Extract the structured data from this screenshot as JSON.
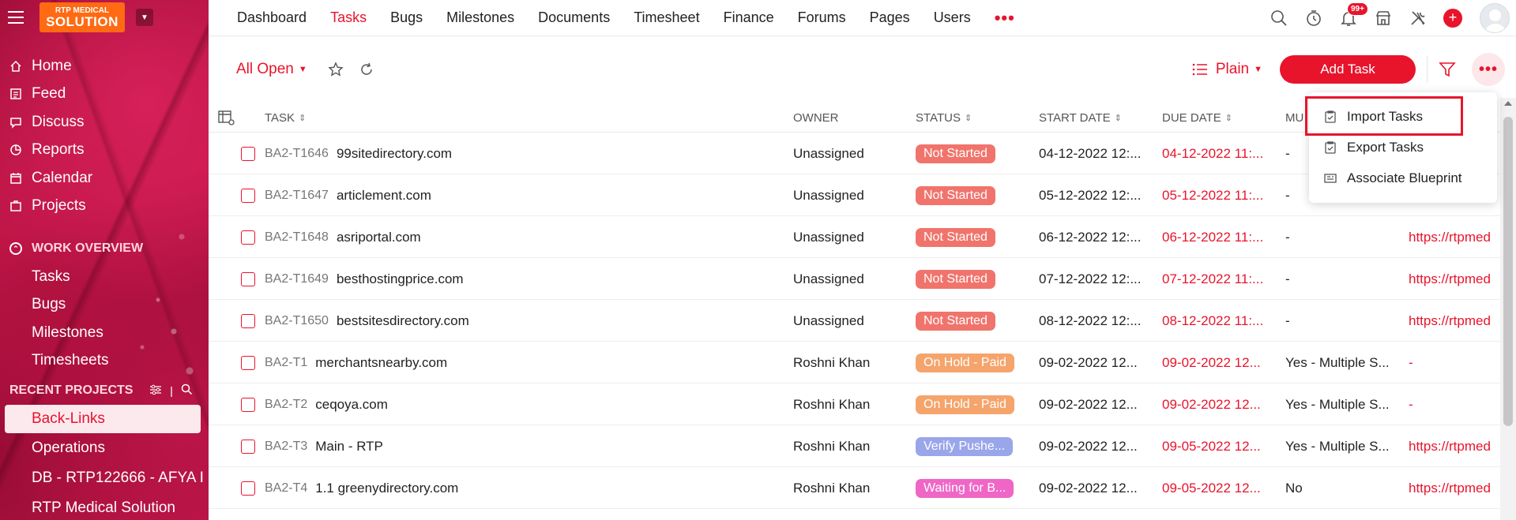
{
  "sidebar": {
    "logo": {
      "line1": "RTP MEDICAL",
      "line2": "SOLUTION"
    },
    "nav": [
      {
        "label": "Home",
        "icon": "home-icon"
      },
      {
        "label": "Feed",
        "icon": "feed-icon"
      },
      {
        "label": "Discuss",
        "icon": "discuss-icon"
      },
      {
        "label": "Reports",
        "icon": "reports-icon"
      },
      {
        "label": "Calendar",
        "icon": "calendar-icon"
      },
      {
        "label": "Projects",
        "icon": "projects-icon"
      }
    ],
    "work_overview": {
      "title": "WORK OVERVIEW",
      "items": [
        "Tasks",
        "Bugs",
        "Milestones",
        "Timesheets"
      ]
    },
    "recent_projects": {
      "title": "RECENT PROJECTS",
      "items": [
        "Back-Links",
        "Operations",
        "DB - RTP122666 - AFYA I",
        "RTP Medical Solution"
      ]
    }
  },
  "topnav": {
    "items": [
      "Dashboard",
      "Tasks",
      "Bugs",
      "Milestones",
      "Documents",
      "Timesheet",
      "Finance",
      "Forums",
      "Pages",
      "Users"
    ],
    "active": "Tasks",
    "more": "•••",
    "notification_count": "99+"
  },
  "toolbar": {
    "view": "All Open",
    "layout": "Plain",
    "add_task": "Add Task",
    "more": "•••"
  },
  "table": {
    "headers": {
      "task": "TASK",
      "owner": "OWNER",
      "status": "STATUS",
      "start": "START DATE",
      "due": "DUE DATE",
      "mu": "MU"
    },
    "rows": [
      {
        "id": "BA2-T1646",
        "name": "99sitedirectory.com",
        "owner": "Unassigned",
        "status": "Not Started",
        "status_color": "#f0746c",
        "start": "04-12-2022 12:...",
        "due": "04-12-2022 11:...",
        "multi": "-",
        "link": ""
      },
      {
        "id": "BA2-T1647",
        "name": "articlement.com",
        "owner": "Unassigned",
        "status": "Not Started",
        "status_color": "#f0746c",
        "start": "05-12-2022 12:...",
        "due": "05-12-2022 11:...",
        "multi": "-",
        "link": ""
      },
      {
        "id": "BA2-T1648",
        "name": "asriportal.com",
        "owner": "Unassigned",
        "status": "Not Started",
        "status_color": "#f0746c",
        "start": "06-12-2022 12:...",
        "due": "06-12-2022 11:...",
        "multi": "-",
        "link": "https://rtpmed"
      },
      {
        "id": "BA2-T1649",
        "name": "besthostingprice.com",
        "owner": "Unassigned",
        "status": "Not Started",
        "status_color": "#f0746c",
        "start": "07-12-2022 12:...",
        "due": "07-12-2022 11:...",
        "multi": "-",
        "link": "https://rtpmed"
      },
      {
        "id": "BA2-T1650",
        "name": "bestsitesdirectory.com",
        "owner": "Unassigned",
        "status": "Not Started",
        "status_color": "#f0746c",
        "start": "08-12-2022 12:...",
        "due": "08-12-2022 11:...",
        "multi": "-",
        "link": "https://rtpmed"
      },
      {
        "id": "BA2-T1",
        "name": "merchantsnearby.com",
        "owner": "Roshni Khan",
        "status": "On Hold - Paid",
        "status_color": "#f5a46c",
        "start": "09-02-2022 12...",
        "due": "09-02-2022 12...",
        "multi": "Yes - Multiple S...",
        "link": "-"
      },
      {
        "id": "BA2-T2",
        "name": "ceqoya.com",
        "owner": "Roshni Khan",
        "status": "On Hold - Paid",
        "status_color": "#f5a46c",
        "start": "09-02-2022 12...",
        "due": "09-02-2022 12...",
        "multi": "Yes - Multiple S...",
        "link": "-"
      },
      {
        "id": "BA2-T3",
        "name": "Main - RTP",
        "owner": "Roshni Khan",
        "status": "Verify Pushe...",
        "status_color": "#9aa6ea",
        "start": "09-02-2022 12...",
        "due": "09-05-2022 12...",
        "multi": "Yes - Multiple S...",
        "link": "https://rtpmed"
      },
      {
        "id": "BA2-T4",
        "name": "1.1 greenydirectory.com",
        "owner": "Roshni Khan",
        "status": "Waiting for B...",
        "status_color": "#ef66c6",
        "start": "09-02-2022 12...",
        "due": "09-05-2022 12...",
        "multi": "No",
        "link": "https://rtpmed"
      }
    ]
  },
  "dropdown": {
    "items": [
      {
        "label": "Import Tasks",
        "icon": "import-icon"
      },
      {
        "label": "Export Tasks",
        "icon": "export-icon"
      },
      {
        "label": "Associate Blueprint",
        "icon": "blueprint-icon"
      }
    ]
  },
  "colors": {
    "accent": "#e8142c"
  }
}
